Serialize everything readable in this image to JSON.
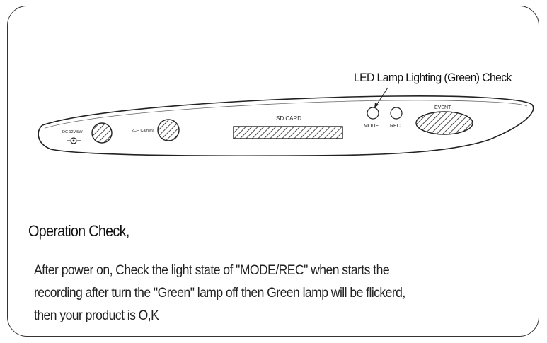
{
  "callout": {
    "text": "LED Lamp Lighting (Green) Check"
  },
  "device": {
    "dc_label": "DC  12V,5W",
    "camera_label": "2CH Camera",
    "sd_card_label": "SD CARD",
    "mode_label": "MODE",
    "rec_label": "REC",
    "event_label": "EVENT"
  },
  "section": {
    "heading": "Operation Check,",
    "lines": [
      "After power on, Check the light state of \"MODE/REC\" when starts the",
      "recording after turn the \"Green\" lamp off  then Green lamp will be flickerd,",
      "then your product is O,K"
    ]
  }
}
